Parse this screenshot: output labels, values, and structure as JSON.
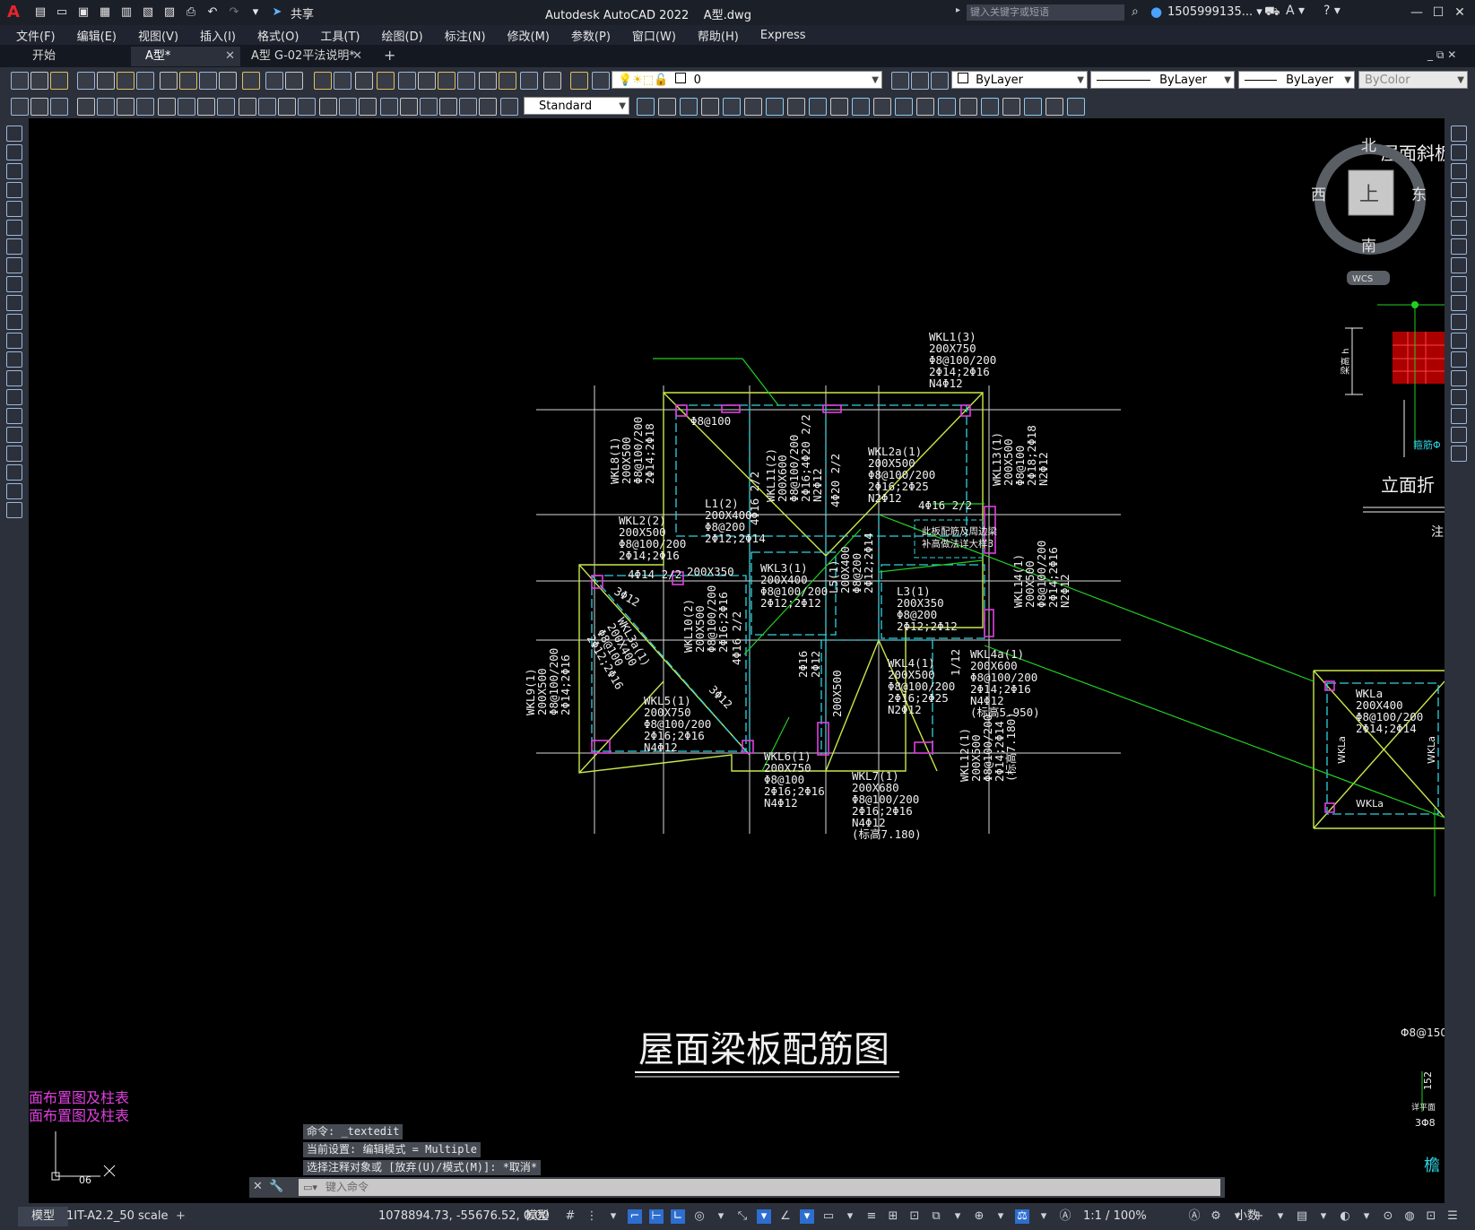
{
  "app": {
    "logo": "A",
    "title": "Autodesk AutoCAD 2022",
    "file": "A型.dwg",
    "share": "共享",
    "search_placeholder": "键入关键字或短语",
    "user": "1505999135...",
    "window_controls": {
      "minimize": "—",
      "restore": "☐",
      "close": "✕"
    }
  },
  "menus": [
    "文件(F)",
    "编辑(E)",
    "视图(V)",
    "插入(I)",
    "格式(O)",
    "工具(T)",
    "绘图(D)",
    "标注(N)",
    "修改(M)",
    "参数(P)",
    "窗口(W)",
    "帮助(H)",
    "Express"
  ],
  "tabs": [
    {
      "label": "开始",
      "closable": false
    },
    {
      "label": "A型*",
      "closable": true
    },
    {
      "label": "A型 G-02平法说明*",
      "closable": true
    }
  ],
  "tab_add": "+",
  "properties": {
    "layer": "0",
    "color": "ByLayer",
    "linetype": "ByLayer",
    "lineweight": "ByLayer",
    "plotstyle": "ByColor",
    "textstyle": "Standard"
  },
  "viewcube": {
    "north": "北",
    "south": "南",
    "east": "东",
    "west": "西",
    "face": "上",
    "wcs": "WCS"
  },
  "drawing": {
    "title": "屋面梁板配筋图",
    "beams": [
      {
        "lines": [
          "WKL1(3)",
          "200X750",
          "Φ8@100/200",
          "2Φ14;2Φ16",
          "N4Φ12"
        ]
      },
      {
        "lines": [
          "WKL2(2)",
          "200X500",
          "Φ8@100/200",
          "2Φ14;2Φ16"
        ]
      },
      {
        "lines": [
          "L1(2)",
          "200X400",
          "Φ8@200",
          "2Φ12;2Φ14"
        ]
      },
      {
        "lines": [
          "WKL2a(1)",
          "200X500",
          "Φ8@100/200",
          "2Φ16;2Φ25",
          "N2Φ12"
        ]
      },
      {
        "lines": [
          "WKL3(1)",
          "200X400",
          "Φ8@100/200",
          "2Φ12;2Φ12"
        ]
      },
      {
        "lines": [
          "L3(1)",
          "200X350",
          "Φ8@200",
          "2Φ12;2Φ12"
        ]
      },
      {
        "lines": [
          "WKL4(1)",
          "200X500",
          "Φ8@100/200",
          "2Φ16;2Φ25",
          "N2Φ12"
        ]
      },
      {
        "lines": [
          "WKL4a(1)",
          "200X600",
          "Φ8@100/200",
          "2Φ14;2Φ16",
          "N4Φ12",
          "(标高5.950)"
        ]
      },
      {
        "lines": [
          "WKL5(1)",
          "200X750",
          "Φ8@100/200",
          "2Φ16;2Φ16",
          "N4Φ12"
        ]
      },
      {
        "lines": [
          "WKL6(1)",
          "200X750",
          "Φ8@100",
          "2Φ16;2Φ16",
          "N4Φ12"
        ]
      },
      {
        "lines": [
          "WKL7(1)",
          "200X680",
          "Φ8@100/200",
          "2Φ16;2Φ16",
          "N4Φ12",
          "(标高7.180)"
        ]
      },
      {
        "lines": [
          "WKLa",
          "200X400",
          "Φ8@100/200",
          "2Φ14;2Φ14"
        ]
      }
    ],
    "vertical_beams": [
      {
        "lines": [
          "WKL8(1)",
          "200X500",
          "Φ8@100/200",
          "2Φ14;2Φ18"
        ]
      },
      {
        "lines": [
          "WKL11(2)",
          "200X600",
          "Φ8@100/200",
          "2Φ16;4Φ20 2/2",
          "N2Φ12"
        ]
      },
      {
        "lines": [
          "WKL13(1)",
          "200X500",
          "Φ8@100",
          "2Φ18;2Φ18",
          "N2Φ12"
        ]
      },
      {
        "lines": [
          "WKL14(1)",
          "200X500",
          "Φ8@100/200",
          "2Φ14;2Φ16",
          "N2Φ12"
        ]
      },
      {
        "lines": [
          "WKL10(2)",
          "200X500",
          "Φ8@100/200",
          "2Φ16;2Φ16"
        ]
      },
      {
        "lines": [
          "WKL9(1)",
          "200X500",
          "Φ8@100/200",
          "2Φ14;2Φ16"
        ]
      },
      {
        "lines": [
          "WKL3a(1)",
          "200X400",
          "Φ8@100",
          "2Φ12;2Φ16"
        ]
      },
      {
        "lines": [
          "L5(1)",
          "200X400",
          "Φ8@200",
          "2Φ12;2Φ14"
        ]
      },
      {
        "lines": [
          "WKL12(1)",
          "200X500",
          "Φ8@100/200",
          "2Φ14;2Φ14",
          "(标高7.180)"
        ]
      }
    ],
    "annotations": [
      "Φ8@100",
      "4Φ16 2/2",
      "4Φ20 2/2",
      "4Φ16 2/2",
      "4Φ14 2/2",
      "200X350",
      "3Φ12",
      "3Φ12",
      "4Φ16 2/2",
      "2Φ16",
      "2Φ12",
      "200X500",
      "1/12"
    ],
    "note_box": [
      "此板配筋及周边梁",
      "补高做法详大样3"
    ],
    "right_labels": [
      "屋面斜板",
      "立面折",
      "注",
      "箍筋Φ",
      "梁高 h",
      "Φ8@150",
      "152",
      "3Φ8",
      "详平面",
      "檐"
    ],
    "wkla_labels": [
      "WKLa",
      "WKLa",
      "WKLa"
    ],
    "bottom_left": [
      "面布置图及柱表",
      "面布置图及柱表"
    ],
    "ucs_label": "06"
  },
  "command": {
    "history": [
      "命令: _textedit",
      "当前设置: 编辑模式 = Multiple",
      "选择注释对象或 [放弃(U)/模式(M)]: *取消*"
    ],
    "placeholder": "键入命令"
  },
  "status": {
    "tabs": [
      "模型",
      "1IT-A2.2_50 scale"
    ],
    "coords": "1078894.73, -55676.52, 0.00",
    "space": "模型",
    "scale": "1:1 / 100%",
    "units": "小数"
  }
}
